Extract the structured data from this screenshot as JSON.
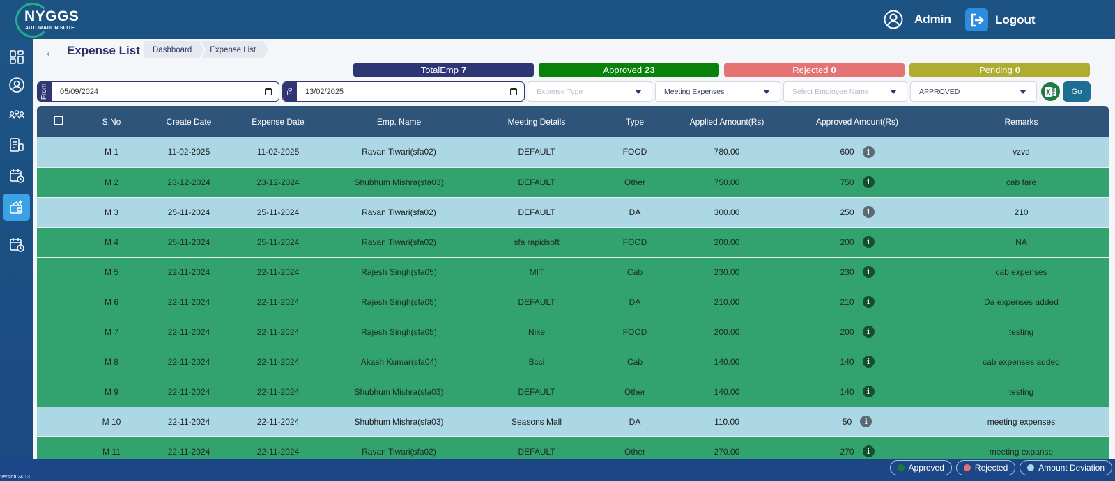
{
  "header": {
    "logo_text": "NYGGS",
    "logo_sub": "AUTOMATION SUITE",
    "user_name": "Admin",
    "logout_label": "Logout"
  },
  "sidebar": {
    "items": [
      {
        "icon": "dashboard-grid-icon",
        "active": false
      },
      {
        "icon": "user-profile-icon",
        "active": false
      },
      {
        "icon": "team-icon",
        "active": false
      },
      {
        "icon": "report-document-icon",
        "active": false
      },
      {
        "icon": "calendar-clock-icon",
        "active": false
      },
      {
        "icon": "wallet-icon",
        "active": true
      },
      {
        "icon": "calendar-schedule-icon",
        "active": false
      }
    ],
    "version": "Version 24.13"
  },
  "page": {
    "title": "Expense List",
    "breadcrumb": [
      "Dashboard",
      "Expense List"
    ]
  },
  "stats": [
    {
      "label": "TotalEmp",
      "value": "7",
      "color": "#2e3575"
    },
    {
      "label": "Approved",
      "value": "23",
      "color": "#08820a"
    },
    {
      "label": "Rejected",
      "value": "0",
      "color": "#e57373"
    },
    {
      "label": "Pending",
      "value": "0",
      "color": "#aead2f"
    }
  ],
  "filters": {
    "from_label": "From",
    "from_date": "05/09/2024",
    "to_label": "To",
    "to_date": "13/02/2025",
    "expense_type_placeholder": "Expense Type",
    "category_value": "Meeting Expenses",
    "employee_placeholder": "Select Employee Name",
    "status_value": "APPROVED",
    "go_label": "Go"
  },
  "table": {
    "columns": [
      "S.No",
      "Create Date",
      "Expense Date",
      "Emp. Name",
      "Meeting Details",
      "Type",
      "Applied Amount(Rs)",
      "Approved Amount(Rs)",
      "Remarks"
    ],
    "rows": [
      {
        "sno": "M 1",
        "create": "11-02-2025",
        "expense": "11-02-2025",
        "emp": "Ravan Tiwari(sfa02)",
        "meeting": "DEFAULT",
        "type": "FOOD",
        "applied": "780.00",
        "approved": "600",
        "remarks": "vzvd",
        "status": "deviation"
      },
      {
        "sno": "M 2",
        "create": "23-12-2024",
        "expense": "23-12-2024",
        "emp": "Shubhum Mishra(sfa03)",
        "meeting": "DEFAULT",
        "type": "Other",
        "applied": "750.00",
        "approved": "750",
        "remarks": "cab fare",
        "status": "approved"
      },
      {
        "sno": "M 3",
        "create": "25-11-2024",
        "expense": "25-11-2024",
        "emp": "Ravan Tiwari(sfa02)",
        "meeting": "DEFAULT",
        "type": "DA",
        "applied": "300.00",
        "approved": "250",
        "remarks": "210",
        "status": "deviation"
      },
      {
        "sno": "M 4",
        "create": "25-11-2024",
        "expense": "25-11-2024",
        "emp": "Ravan Tiwari(sfa02)",
        "meeting": "sfa rapidsoft",
        "type": "FOOD",
        "applied": "200.00",
        "approved": "200",
        "remarks": "NA",
        "status": "approved"
      },
      {
        "sno": "M 5",
        "create": "22-11-2024",
        "expense": "22-11-2024",
        "emp": "Rajesh Singh(sfa05)",
        "meeting": "MIT",
        "type": "Cab",
        "applied": "230.00",
        "approved": "230",
        "remarks": "cab expenses",
        "status": "approved"
      },
      {
        "sno": "M 6",
        "create": "22-11-2024",
        "expense": "22-11-2024",
        "emp": "Rajesh Singh(sfa05)",
        "meeting": "DEFAULT",
        "type": "DA",
        "applied": "210.00",
        "approved": "210",
        "remarks": "Da expenses added",
        "status": "approved"
      },
      {
        "sno": "M 7",
        "create": "22-11-2024",
        "expense": "22-11-2024",
        "emp": "Rajesh Singh(sfa05)",
        "meeting": "Nike",
        "type": "FOOD",
        "applied": "200.00",
        "approved": "200",
        "remarks": "testing",
        "status": "approved"
      },
      {
        "sno": "M 8",
        "create": "22-11-2024",
        "expense": "22-11-2024",
        "emp": "Akash Kumar(sfa04)",
        "meeting": "Bcci",
        "type": "Cab",
        "applied": "140.00",
        "approved": "140",
        "remarks": "cab expenses added",
        "status": "approved"
      },
      {
        "sno": "M 9",
        "create": "22-11-2024",
        "expense": "22-11-2024",
        "emp": "Shubhum Mishra(sfa03)",
        "meeting": "DEFAULT",
        "type": "Other",
        "applied": "140.00",
        "approved": "140",
        "remarks": "testing",
        "status": "approved"
      },
      {
        "sno": "M 10",
        "create": "22-11-2024",
        "expense": "22-11-2024",
        "emp": "Shubhum Mishra(sfa03)",
        "meeting": "Seasons Mall",
        "type": "DA",
        "applied": "110.00",
        "approved": "50",
        "remarks": "meeting expenses",
        "status": "deviation"
      },
      {
        "sno": "M 11",
        "create": "22-11-2024",
        "expense": "22-11-2024",
        "emp": "Ravan Tiwari(sfa02)",
        "meeting": "DEFAULT",
        "type": "Other",
        "applied": "270.00",
        "approved": "270",
        "remarks": "meeting expanse",
        "status": "approved"
      }
    ]
  },
  "legend": [
    {
      "label": "Approved",
      "color": "#1f7a36"
    },
    {
      "label": "Rejected",
      "color": "#e57373"
    },
    {
      "label": "Amount Deviation",
      "color": "#acd8e6"
    }
  ]
}
